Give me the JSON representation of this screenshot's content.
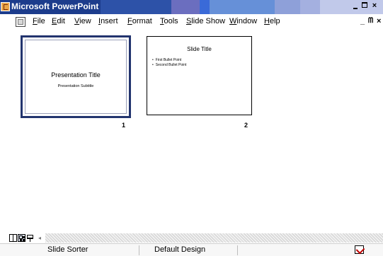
{
  "window": {
    "title": "Microsoft PowerPoint",
    "controls": {
      "minimize": "",
      "maximize": "",
      "close": "×"
    },
    "mdi_controls": {
      "minimize": "_",
      "restore": "ᗰ",
      "close": "×"
    }
  },
  "menu": {
    "items": [
      {
        "label": "File"
      },
      {
        "label": "Edit"
      },
      {
        "label": "View"
      },
      {
        "label": "Insert"
      },
      {
        "label": "Format"
      },
      {
        "label": "Tools"
      },
      {
        "label": "Slide Show"
      },
      {
        "label": "Window"
      },
      {
        "label": "Help"
      }
    ]
  },
  "slides": [
    {
      "number": "1",
      "title": "Presentation Title",
      "subtitle": "Presentation Subtitle",
      "selected": true
    },
    {
      "number": "2",
      "title": "Slide Title",
      "bullets": [
        "First Bullet Point",
        "Second Bullet Point"
      ],
      "selected": false
    }
  ],
  "viewbar": {
    "scroll_left": "◂"
  },
  "status": {
    "view": "Slide Sorter",
    "design": "Default Design"
  },
  "colors": {
    "titlebar": "#1c3c8c",
    "selection_border": "#22346e"
  }
}
